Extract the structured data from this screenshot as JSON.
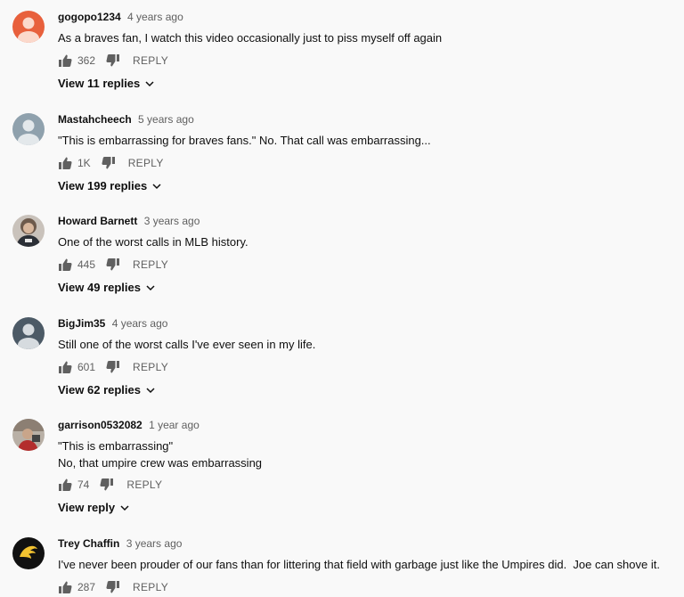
{
  "comments": [
    {
      "author": "gogopo1234",
      "time": "4 years ago",
      "text": [
        "As a braves fan, I watch this video occasionally just to piss myself off again"
      ],
      "likes": "362",
      "reply_label": "REPLY",
      "view_replies": "View 11 replies",
      "avatar_color": "#e8603c",
      "avatar_icon": "person-icon"
    },
    {
      "author": "Mastahcheech",
      "time": "5 years ago",
      "text": [
        "\"This is embarrassing for braves fans.\" No. That call was embarrassing..."
      ],
      "likes": "1K",
      "reply_label": "REPLY",
      "view_replies": "View 199 replies",
      "avatar_color": "#8fa1ad",
      "avatar_icon": "person-icon"
    },
    {
      "author": "Howard Barnett",
      "time": "3 years ago",
      "text": [
        "One of the worst calls in MLB history."
      ],
      "likes": "445",
      "reply_label": "REPLY",
      "view_replies": "View 49 replies",
      "avatar_color": "#7a6e66",
      "avatar_icon": "photo-avatar"
    },
    {
      "author": "BigJim35",
      "time": "4 years ago",
      "text": [
        "Still one of the worst calls I've ever seen in my life."
      ],
      "likes": "601",
      "reply_label": "REPLY",
      "view_replies": "View 62 replies",
      "avatar_color": "#4c5a66",
      "avatar_icon": "person-icon"
    },
    {
      "author": "garrison0532082",
      "time": "1 year ago",
      "text": [
        "\"This is embarrassing\"",
        "No, that umpire crew was embarrassing"
      ],
      "likes": "74",
      "reply_label": "REPLY",
      "view_replies": "View reply",
      "avatar_color": "#8a7a70",
      "avatar_icon": "photo-avatar"
    },
    {
      "author": "Trey Chaffin",
      "time": "3 years ago",
      "text": [
        "I've never been prouder of our fans than for littering that field with garbage just like the Umpires did.  Joe can shove it."
      ],
      "likes": "287",
      "reply_label": "REPLY",
      "view_replies": "",
      "avatar_color": "#111111",
      "avatar_icon": "logo-avatar"
    }
  ],
  "colors": {
    "background": "#f9f9f9",
    "primary_text": "#0f0f0f",
    "secondary_text": "#606060"
  }
}
